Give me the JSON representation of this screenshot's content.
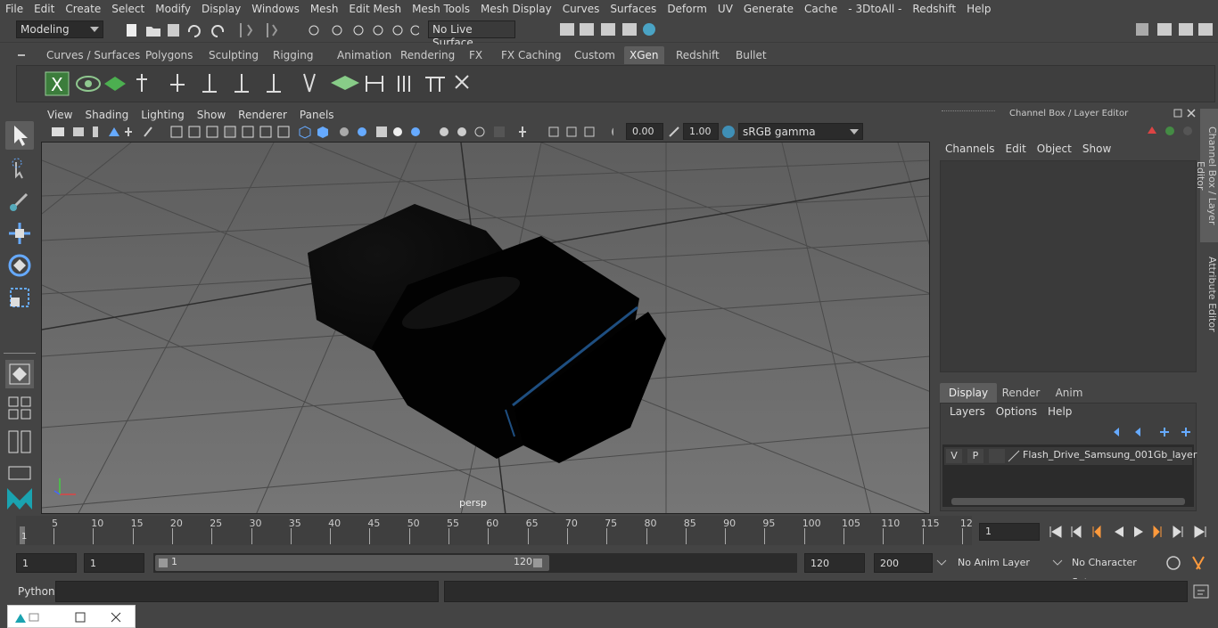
{
  "menu": [
    "File",
    "Edit",
    "Create",
    "Select",
    "Modify",
    "Display",
    "Windows",
    "Mesh",
    "Edit Mesh",
    "Mesh Tools",
    "Mesh Display",
    "Curves",
    "Surfaces",
    "Deform",
    "UV",
    "Generate",
    "Cache",
    "- 3DtoAll -",
    "Redshift",
    "Help"
  ],
  "status": {
    "mode": "Modeling",
    "live_surface": "No Live Surface"
  },
  "shelf_tabs": [
    "Curves / Surfaces",
    "Polygons",
    "Sculpting",
    "Rigging",
    "Animation",
    "Rendering",
    "FX",
    "FX Caching",
    "Custom",
    "XGen",
    "Redshift",
    "Bullet"
  ],
  "active_shelf": "XGen",
  "viewport": {
    "menu": [
      "View",
      "Shading",
      "Lighting",
      "Show",
      "Renderer",
      "Panels"
    ],
    "exposure": "0.00",
    "gamma": "1.00",
    "colorspace": "sRGB gamma",
    "camera": "persp"
  },
  "channel_box": {
    "title": "Channel Box / Layer Editor",
    "menu": [
      "Channels",
      "Edit",
      "Object",
      "Show"
    ],
    "layer_tabs": [
      "Display",
      "Render",
      "Anim"
    ],
    "active_layer_tab": "Display",
    "layer_menu": [
      "Layers",
      "Options",
      "Help"
    ],
    "layer": {
      "v": "V",
      "p": "P",
      "name": "Flash_Drive_Samsung_001Gb_layer"
    }
  },
  "side_tabs": [
    "Channel Box / Layer Editor",
    "Attribute Editor"
  ],
  "timeline": {
    "ticks": [
      "5",
      "10",
      "15",
      "20",
      "25",
      "30",
      "35",
      "40",
      "45",
      "50",
      "55",
      "60",
      "65",
      "70",
      "75",
      "80",
      "85",
      "90",
      "95",
      "100",
      "105",
      "110",
      "115",
      "12"
    ],
    "start_mark": "1",
    "current_frame": "1"
  },
  "range": {
    "start": "1",
    "start2": "1",
    "slider_start": "1",
    "slider_end": "120",
    "end": "120",
    "max": "200",
    "anim_layer": "No Anim Layer",
    "char_set": "No Character Set"
  },
  "cmd": {
    "label": "Python"
  },
  "colors": {
    "accent": "#5285a6",
    "bg": "#444444",
    "field": "#2b2b2b",
    "viewport_bg": "#6a6a6a"
  }
}
